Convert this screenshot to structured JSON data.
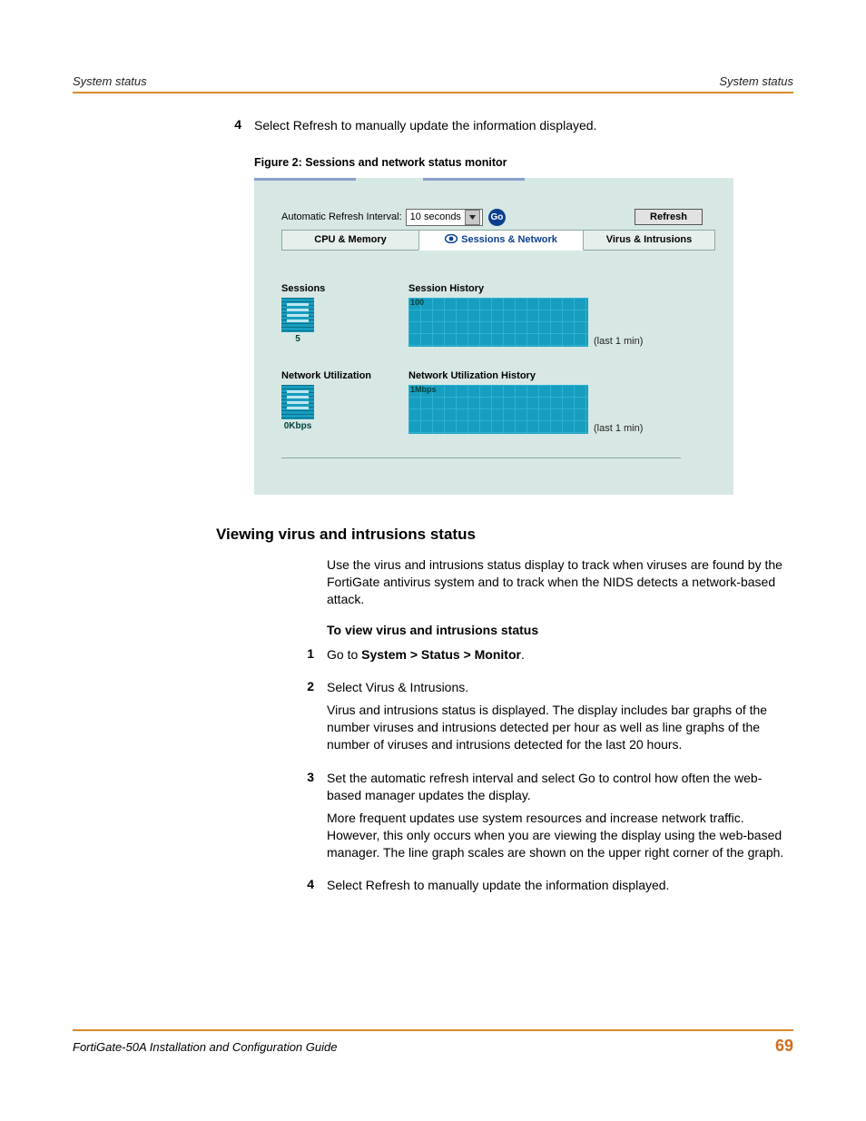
{
  "header": {
    "left": "System status",
    "right": "System status"
  },
  "pre_step": {
    "num": "4",
    "text": "Select Refresh to manually update the information displayed."
  },
  "figure": {
    "caption": "Figure 2:   Sessions and network status monitor",
    "refresh_label": "Automatic Refresh Interval:",
    "refresh_value": "10 seconds",
    "go_label": "Go",
    "refresh_button": "Refresh",
    "tabs": {
      "cpu": "CPU & Memory",
      "sessions": "Sessions & Network",
      "virus": "Virus & Intrusions"
    },
    "sessions": {
      "label": "Sessions",
      "value": "5",
      "history_label": "Session History",
      "history_y": "100",
      "last": "(last 1 min)"
    },
    "network": {
      "label": "Network Utilization",
      "value": "0Kbps",
      "history_label": "Network Utilization History",
      "history_y": "1Mbps",
      "last": "(last 1 min)"
    }
  },
  "section": {
    "heading": "Viewing virus and intrusions status",
    "intro": "Use the virus and intrusions status display to track when viruses are found by the FortiGate antivirus system and to track when the NIDS detects a network-based attack.",
    "subheading": "To view virus and intrusions status",
    "steps": [
      {
        "num": "1",
        "p1a": "Go to ",
        "p1b": "System > Status > Monitor",
        "p1c": "."
      },
      {
        "num": "2",
        "p1": "Select Virus & Intrusions.",
        "p2": "Virus and intrusions status is displayed. The display includes bar graphs of the number viruses and intrusions detected per hour as well as line graphs of the number of viruses and intrusions detected for the last 20 hours."
      },
      {
        "num": "3",
        "p1": "Set the automatic refresh interval and select Go to control how often the web-based manager updates the display.",
        "p2": "More frequent updates use system resources and increase network traffic. However, this only occurs when you are viewing the display using the web-based manager. The line graph scales are shown on the upper right corner of the graph."
      },
      {
        "num": "4",
        "p1": "Select Refresh to manually update the information displayed."
      }
    ]
  },
  "footer": {
    "left": "FortiGate-50A Installation and Configuration Guide",
    "right": "69"
  }
}
